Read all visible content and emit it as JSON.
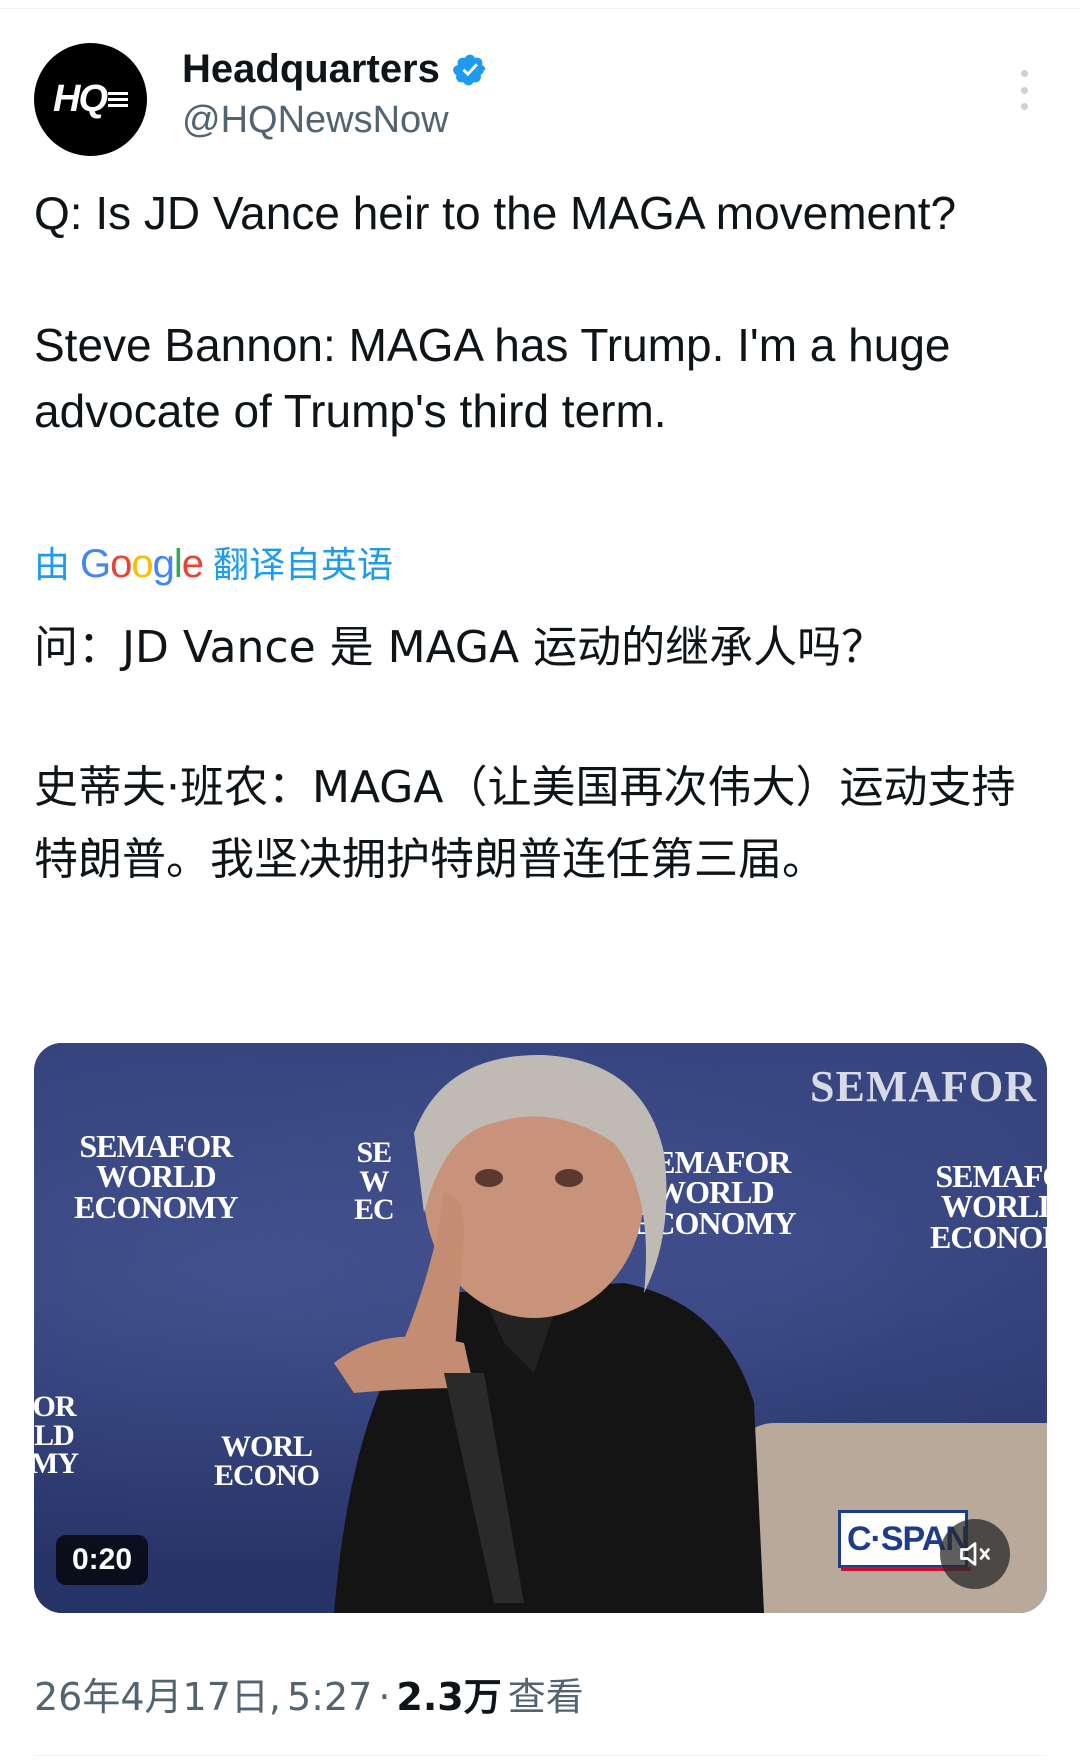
{
  "author": {
    "avatar_text": "HQ",
    "display_name": "Headquarters",
    "handle": "@HQNewsNow",
    "verified": true
  },
  "tweet": {
    "paragraph_1": "Q: Is JD Vance heir to the MAGA movement?",
    "paragraph_2": "Steve Bannon: MAGA has Trump. I'm a huge advocate of Trump's third term."
  },
  "translation": {
    "prefix": "由",
    "provider": "Google",
    "suffix": "翻译自英语",
    "paragraph_1": "问：JD Vance 是 MAGA 运动的继承人吗？",
    "paragraph_2": "史蒂夫·班农：MAGA（让美国再次伟大）运动支持特朗普。我坚决拥护特朗普连任第三届。"
  },
  "video": {
    "top_banner": "SEMAFOR",
    "backdrop_logo": [
      "SEMAFOR",
      "WORLD",
      "ECONOMY"
    ],
    "partial_logo_1": [
      "SE",
      "W",
      "EC"
    ],
    "partial_logo_2": [
      "OR",
      "LD",
      "MY"
    ],
    "partial_logo_3": [
      "WORL",
      "ECONO"
    ],
    "partial_logo_4": [
      "SEMAFO",
      "WORLD",
      "ECONOM"
    ],
    "duration": "0:20",
    "network_logo": "C·SPAN",
    "muted": true
  },
  "meta": {
    "date": "26年4月17日,",
    "time": "5:27",
    "separator": "·",
    "views": "2.3万",
    "views_label": "查看"
  },
  "colors": {
    "accent": "#1d9bf0",
    "secondary_text": "#536471",
    "primary_text": "#0f1419"
  }
}
